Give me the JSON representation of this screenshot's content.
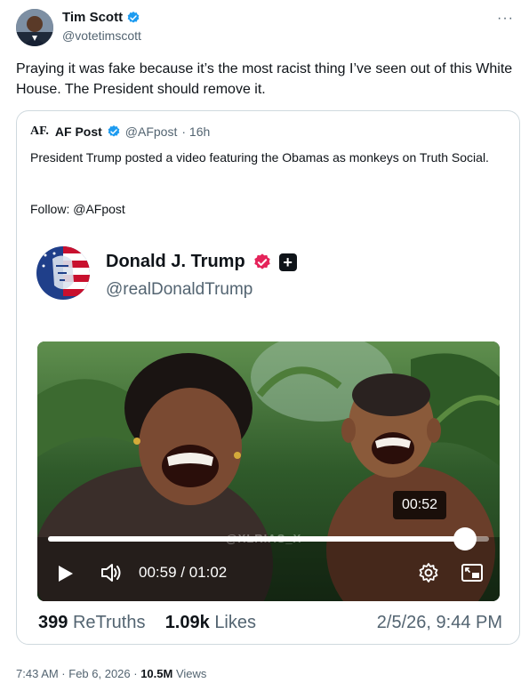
{
  "tweet": {
    "author_name": "Tim Scott",
    "author_handle": "@votetimscott",
    "text": "Praying it was fake because it’s the most racist thing I’ve seen out of this White House. The President should remove it.",
    "more_label": "···"
  },
  "quote": {
    "logo_text": "AF.",
    "author_name": "AF Post",
    "author_handle": "@AFpost",
    "age": "· 16h",
    "text": "President Trump posted a video featuring the Obamas as monkeys on Truth Social.",
    "follow_text": "Follow: @AFpost"
  },
  "truth_post": {
    "author_name": "Donald J. Trump",
    "author_handle": "@realDonaldTrump",
    "plus_badge": "+",
    "video": {
      "watermark": "@XLRIAS_X",
      "hover_time": "00:52",
      "current_time": "00:59",
      "duration": "01:02",
      "time_display": "00:59 / 01:02",
      "progress_percent": 94.5
    },
    "stats": {
      "retruths_count": "399",
      "retruths_label": "ReTruths",
      "likes_count": "1.09k",
      "likes_label": "Likes",
      "date": "2/5/26, 9:44 PM"
    }
  },
  "meta": {
    "time": "7:43 AM · Feb 6, 2026 ·",
    "views_count": "10.5M",
    "views_label": "Views"
  },
  "colors": {
    "verified_blue": "#1d9bf0",
    "truth_badge_red": "#e5235a",
    "text_primary": "#0f1419",
    "text_secondary": "#536471"
  },
  "icons": [
    "verified-badge-icon",
    "more-icon",
    "play-icon",
    "volume-icon",
    "settings-icon",
    "pip-icon"
  ]
}
